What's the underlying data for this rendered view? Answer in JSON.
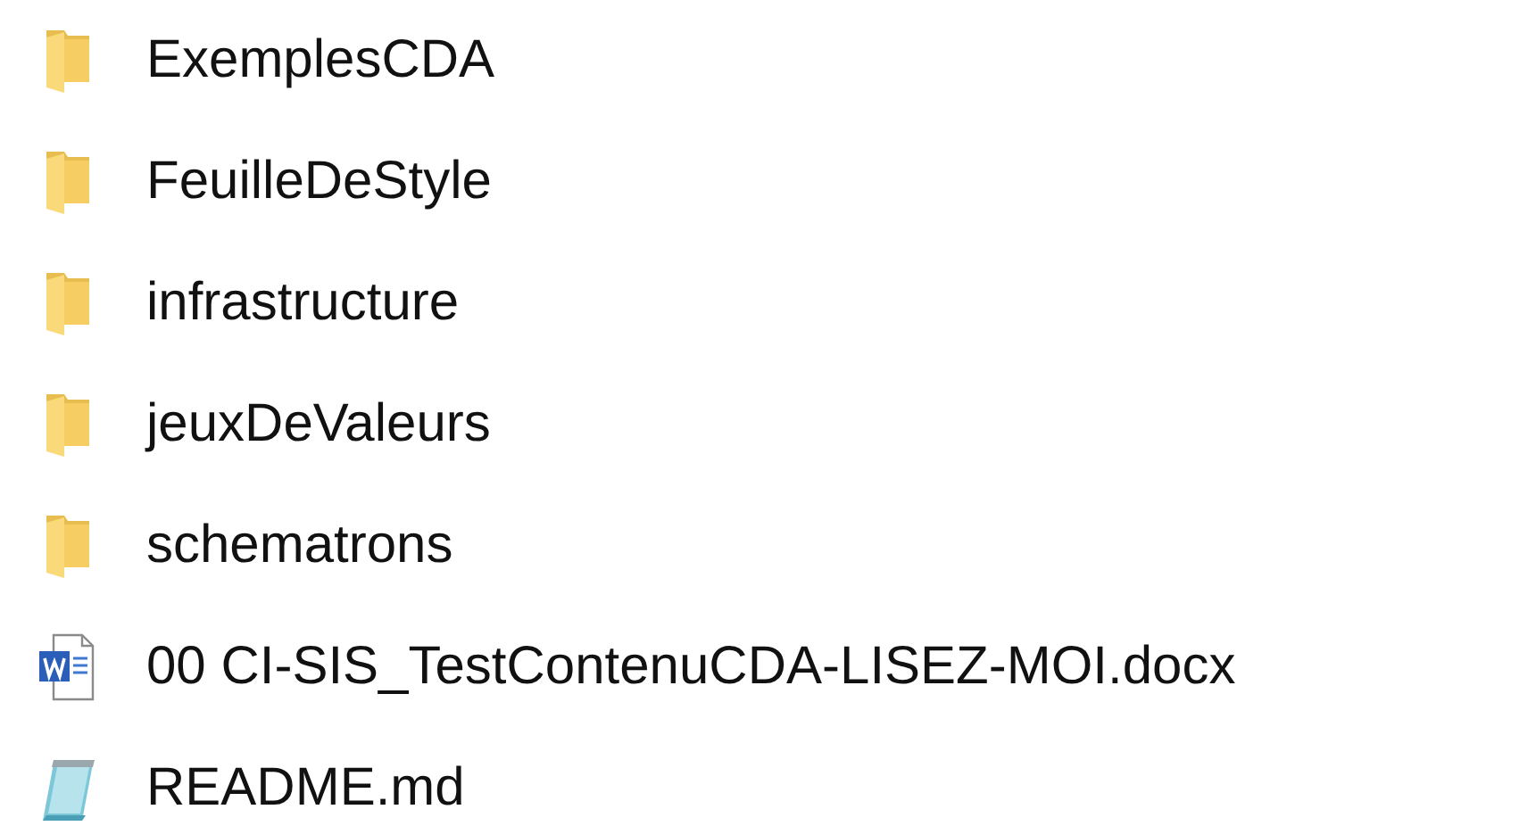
{
  "files": [
    {
      "kind": "folder",
      "name": "ExemplesCDA"
    },
    {
      "kind": "folder",
      "name": "FeuilleDeStyle"
    },
    {
      "kind": "folder",
      "name": "infrastructure"
    },
    {
      "kind": "folder",
      "name": "jeuxDeValeurs"
    },
    {
      "kind": "folder",
      "name": "schematrons"
    },
    {
      "kind": "word",
      "name": "00 CI-SIS_TestContenuCDA-LISEZ-MOI.docx"
    },
    {
      "kind": "notepad",
      "name": "README.md"
    }
  ]
}
